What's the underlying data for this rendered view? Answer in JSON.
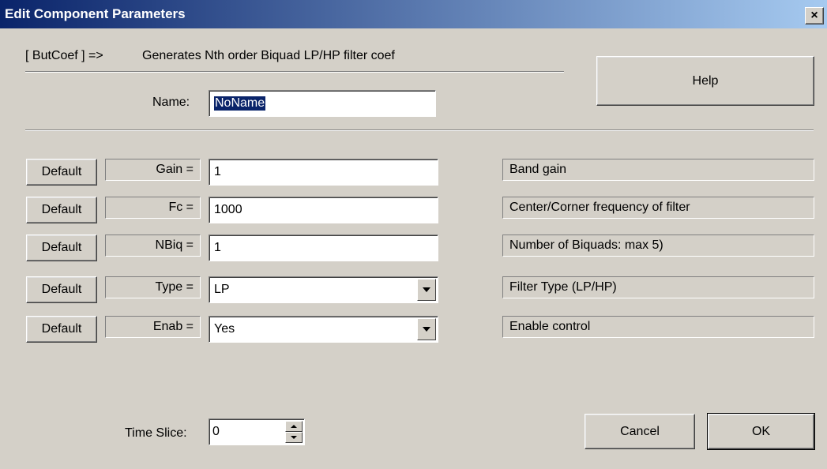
{
  "window": {
    "title": "Edit Component Parameters",
    "close_label": "×"
  },
  "header": {
    "component_tag": "[ ButCoef ] =>",
    "description": "Generates Nth order Biquad LP/HP filter coef"
  },
  "help_button": "Help",
  "name_field": {
    "label": "Name:",
    "value": "NoName"
  },
  "params": [
    {
      "default_label": "Default",
      "label": "Gain =",
      "value": "1",
      "kind": "text",
      "description": "Band gain"
    },
    {
      "default_label": "Default",
      "label": "Fc =",
      "value": "1000",
      "kind": "text",
      "description": "Center/Corner frequency of filter"
    },
    {
      "default_label": "Default",
      "label": "NBiq =",
      "value": "1",
      "kind": "text",
      "description": "Number of Biquads: max 5)"
    },
    {
      "default_label": "Default",
      "label": "Type =",
      "value": "LP",
      "kind": "select",
      "description": "Filter Type (LP/HP)"
    },
    {
      "default_label": "Default",
      "label": "Enab =",
      "value": "Yes",
      "kind": "select",
      "description": "Enable control"
    }
  ],
  "time_slice": {
    "label": "Time Slice:",
    "value": "0"
  },
  "buttons": {
    "cancel": "Cancel",
    "ok": "OK"
  },
  "colors": {
    "face": "#d4d0c8",
    "title_start": "#0a246a",
    "title_end": "#a6caf0",
    "selection": "#0a246a"
  }
}
